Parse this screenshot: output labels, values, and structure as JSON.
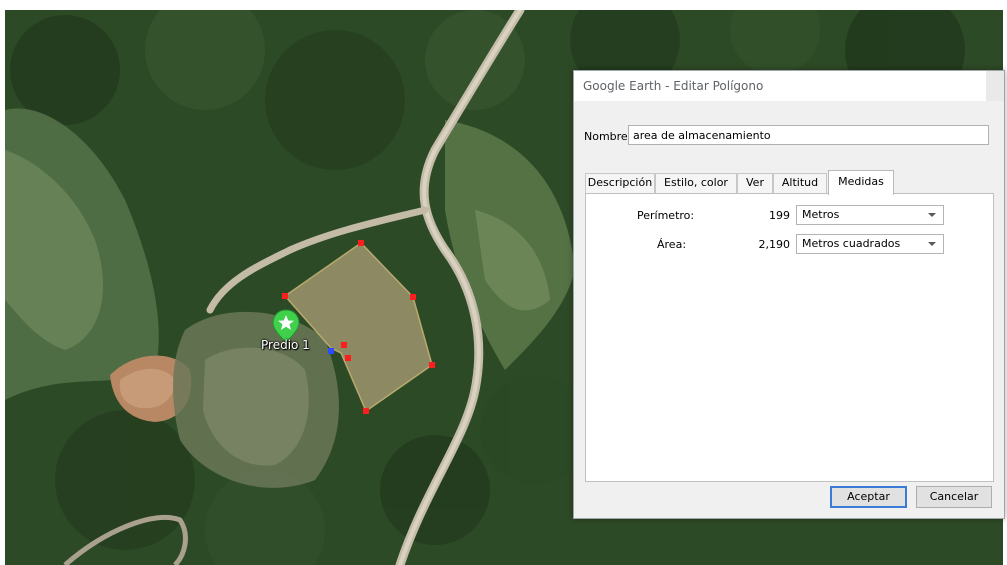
{
  "map": {
    "placemark": {
      "label": "Predio 1",
      "icon": "green-pin-star-icon"
    },
    "polygon": {
      "fill_color": "#97906a",
      "vertex_color": "#ff1e1e"
    }
  },
  "dialog": {
    "title": "Google Earth - Editar Polígono",
    "name_label": "Nombre:",
    "name_value": "area de almacenamiento",
    "tabs": [
      {
        "label": "Descripción",
        "active": false
      },
      {
        "label": "Estilo, color",
        "active": false
      },
      {
        "label": "Ver",
        "active": false
      },
      {
        "label": "Altitud",
        "active": false
      },
      {
        "label": "Medidas",
        "active": true
      }
    ],
    "measurements": {
      "perimeter": {
        "label": "Perímetro:",
        "value": "199",
        "unit": "Metros"
      },
      "area": {
        "label": "Área:",
        "value": "2,190",
        "unit": "Metros cuadrados"
      }
    },
    "buttons": {
      "ok": "Aceptar",
      "cancel": "Cancelar"
    },
    "accent_color": "#3a7bd5"
  }
}
